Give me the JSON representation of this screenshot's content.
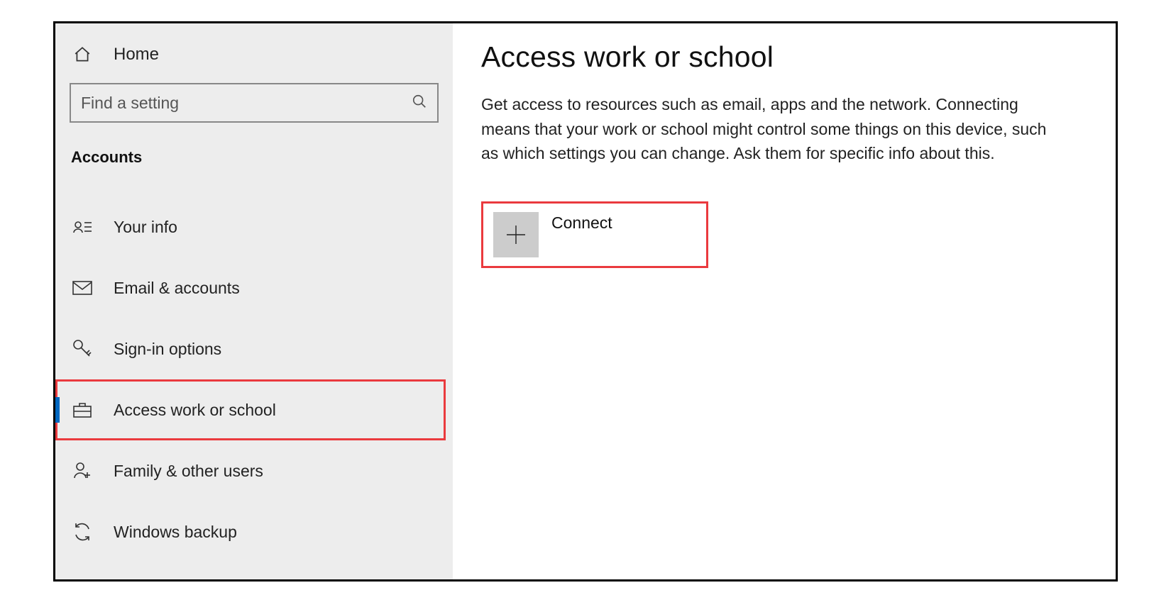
{
  "sidebar": {
    "home_label": "Home",
    "search_placeholder": "Find a setting",
    "section_title": "Accounts",
    "items": [
      {
        "label": "Your info"
      },
      {
        "label": "Email & accounts"
      },
      {
        "label": "Sign-in options"
      },
      {
        "label": "Access work or school"
      },
      {
        "label": "Family & other users"
      },
      {
        "label": "Windows backup"
      }
    ]
  },
  "main": {
    "title": "Access work or school",
    "description": "Get access to resources such as email, apps and the network. Connecting means that your work or school might control some things on this device, such as which settings you can change. Ask them for specific info about this.",
    "connect_label": "Connect"
  },
  "annotation": {
    "highlight_sidebar_index": 3,
    "arrow_color": "#ea3a3e"
  }
}
